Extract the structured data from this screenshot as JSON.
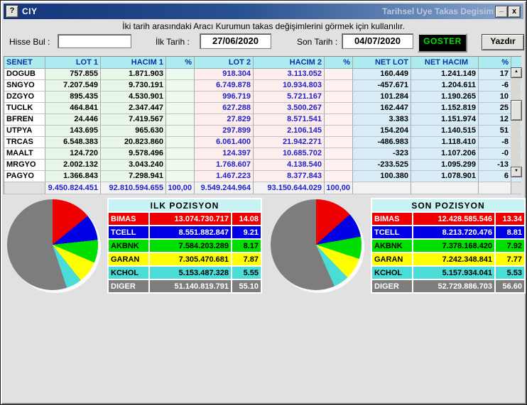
{
  "window": {
    "help_glyph": "?",
    "title_left": "CIY",
    "title_right": "Tarihsel Uye Takas Degisim",
    "minimize_glyph": "_",
    "close_glyph": "x",
    "subtitle": "İki tarih arasındaki Aracı Kurumun takas değişimlerini görmek için kullanılır."
  },
  "form": {
    "hisse_bul_label": "Hisse Bul :",
    "hisse_bul_value": "",
    "ilk_tarih_label": "İlk Tarih :",
    "ilk_tarih_value": "27/06/2020",
    "son_tarih_label": "Son Tarih :",
    "son_tarih_value": "04/07/2020",
    "goster_label": "GOSTER",
    "yazdir_label": "Yazdır"
  },
  "table": {
    "columns": [
      "SENET",
      "LOT 1",
      "HACIM 1",
      "%",
      "LOT 2",
      "HACIM 2",
      "%",
      "NET LOT",
      "NET HACIM",
      "%"
    ],
    "rows": [
      [
        "DOGUB",
        "757.855",
        "1.871.903",
        "",
        "918.304",
        "3.113.052",
        "",
        "160.449",
        "1.241.149",
        "17"
      ],
      [
        "SNGYO",
        "7.207.549",
        "9.730.191",
        "",
        "6.749.878",
        "10.934.803",
        "",
        "-457.671",
        "1.204.611",
        "-6"
      ],
      [
        "DZGYO",
        "895.435",
        "4.530.901",
        "",
        "996.719",
        "5.721.167",
        "",
        "101.284",
        "1.190.265",
        "10"
      ],
      [
        "TUCLK",
        "464.841",
        "2.347.447",
        "",
        "627.288",
        "3.500.267",
        "",
        "162.447",
        "1.152.819",
        "25"
      ],
      [
        "BFREN",
        "24.446",
        "7.419.567",
        "",
        "27.829",
        "8.571.541",
        "",
        "3.383",
        "1.151.974",
        "12"
      ],
      [
        "UTPYA",
        "143.695",
        "965.630",
        "",
        "297.899",
        "2.106.145",
        "",
        "154.204",
        "1.140.515",
        "51"
      ],
      [
        "TRCAS",
        "6.548.383",
        "20.823.860",
        "",
        "6.061.400",
        "21.942.271",
        "",
        "-486.983",
        "1.118.410",
        "-8"
      ],
      [
        "MAALT",
        "124.720",
        "9.578.496",
        "",
        "124.397",
        "10.685.702",
        "",
        "-323",
        "1.107.206",
        "-0"
      ],
      [
        "MRGYO",
        "2.002.132",
        "3.043.240",
        "",
        "1.768.607",
        "4.138.540",
        "",
        "-233.525",
        "1.095.299",
        "-13"
      ],
      [
        "PAGYO",
        "1.366.843",
        "7.298.941",
        "",
        "1.467.223",
        "8.377.843",
        "",
        "100.380",
        "1.078.901",
        "6"
      ]
    ],
    "totals": [
      "",
      "9.450.824.451",
      "92.810.594.655",
      "100,00",
      "9.549.244.964",
      "93.150.644.029",
      "100,00",
      "",
      "",
      ""
    ]
  },
  "positions": {
    "ilk": {
      "title": "ILK POZISYON",
      "rows": [
        {
          "symbol": "BIMAS",
          "value": "13.074.730.717",
          "pct": "14.08",
          "color": "#ee0000",
          "text_color": "#ffffff"
        },
        {
          "symbol": "TCELL",
          "value": "8.551.882.847",
          "pct": "9.21",
          "color": "#0000e6",
          "text_color": "#ffffff"
        },
        {
          "symbol": "AKBNK",
          "value": "7.584.203.289",
          "pct": "8.17",
          "color": "#00e000",
          "text_color": "#000000"
        },
        {
          "symbol": "GARAN",
          "value": "7.305.470.681",
          "pct": "7.87",
          "color": "#ffff00",
          "text_color": "#000000"
        },
        {
          "symbol": "KCHOL",
          "value": "5.153.487.328",
          "pct": "5.55",
          "color": "#4adcd6",
          "text_color": "#000000"
        },
        {
          "symbol": "DIGER",
          "value": "51.140.819.791",
          "pct": "55.10",
          "color": "#7d7d7d",
          "text_color": "#ffffff"
        }
      ]
    },
    "son": {
      "title": "SON POZISYON",
      "rows": [
        {
          "symbol": "BIMAS",
          "value": "12.428.585.546",
          "pct": "13.34",
          "color": "#ee0000",
          "text_color": "#ffffff"
        },
        {
          "symbol": "TCELL",
          "value": "8.213.720.476",
          "pct": "8.81",
          "color": "#0000e6",
          "text_color": "#ffffff"
        },
        {
          "symbol": "AKBNK",
          "value": "7.378.168.420",
          "pct": "7.92",
          "color": "#00e000",
          "text_color": "#000000"
        },
        {
          "symbol": "GARAN",
          "value": "7.242.348.841",
          "pct": "7.77",
          "color": "#ffff00",
          "text_color": "#000000"
        },
        {
          "symbol": "KCHOL",
          "value": "5.157.934.041",
          "pct": "5.53",
          "color": "#4adcd6",
          "text_color": "#000000"
        },
        {
          "symbol": "DIGER",
          "value": "52.729.886.703",
          "pct": "56.60",
          "color": "#7d7d7d",
          "text_color": "#ffffff"
        }
      ]
    }
  },
  "chart_data": [
    {
      "type": "pie",
      "title": "ILK POZISYON",
      "labels": [
        "BIMAS",
        "TCELL",
        "AKBNK",
        "GARAN",
        "KCHOL",
        "DIGER"
      ],
      "values": [
        14.08,
        9.21,
        8.17,
        7.87,
        5.55,
        55.1
      ],
      "colors": [
        "#ee0000",
        "#0000e6",
        "#00e000",
        "#ffff00",
        "#4adcd6",
        "#7d7d7d"
      ],
      "start_angle_deg": 0,
      "direction": "clockwise",
      "legend_position": "table-right"
    },
    {
      "type": "pie",
      "title": "SON POZISYON",
      "labels": [
        "BIMAS",
        "TCELL",
        "AKBNK",
        "GARAN",
        "KCHOL",
        "DIGER"
      ],
      "values": [
        13.34,
        8.81,
        7.92,
        7.77,
        5.53,
        56.6
      ],
      "colors": [
        "#ee0000",
        "#0000e6",
        "#00e000",
        "#ffff00",
        "#4adcd6",
        "#7d7d7d"
      ],
      "start_angle_deg": 0,
      "direction": "clockwise",
      "legend_position": "table-right"
    }
  ],
  "ui_colors": {
    "titlebar_start": "#14347c",
    "titlebar_end": "#8aa7ce",
    "header_bg": "#aeebf0",
    "header_text": "#0037a6",
    "col1_bg": "#e9f7e9",
    "col2_bg": "#fdeded",
    "col2_text": "#2121cc",
    "net_bg": "#d9edf8",
    "goster_text": "#00e000",
    "goster_bg": "#000000"
  }
}
